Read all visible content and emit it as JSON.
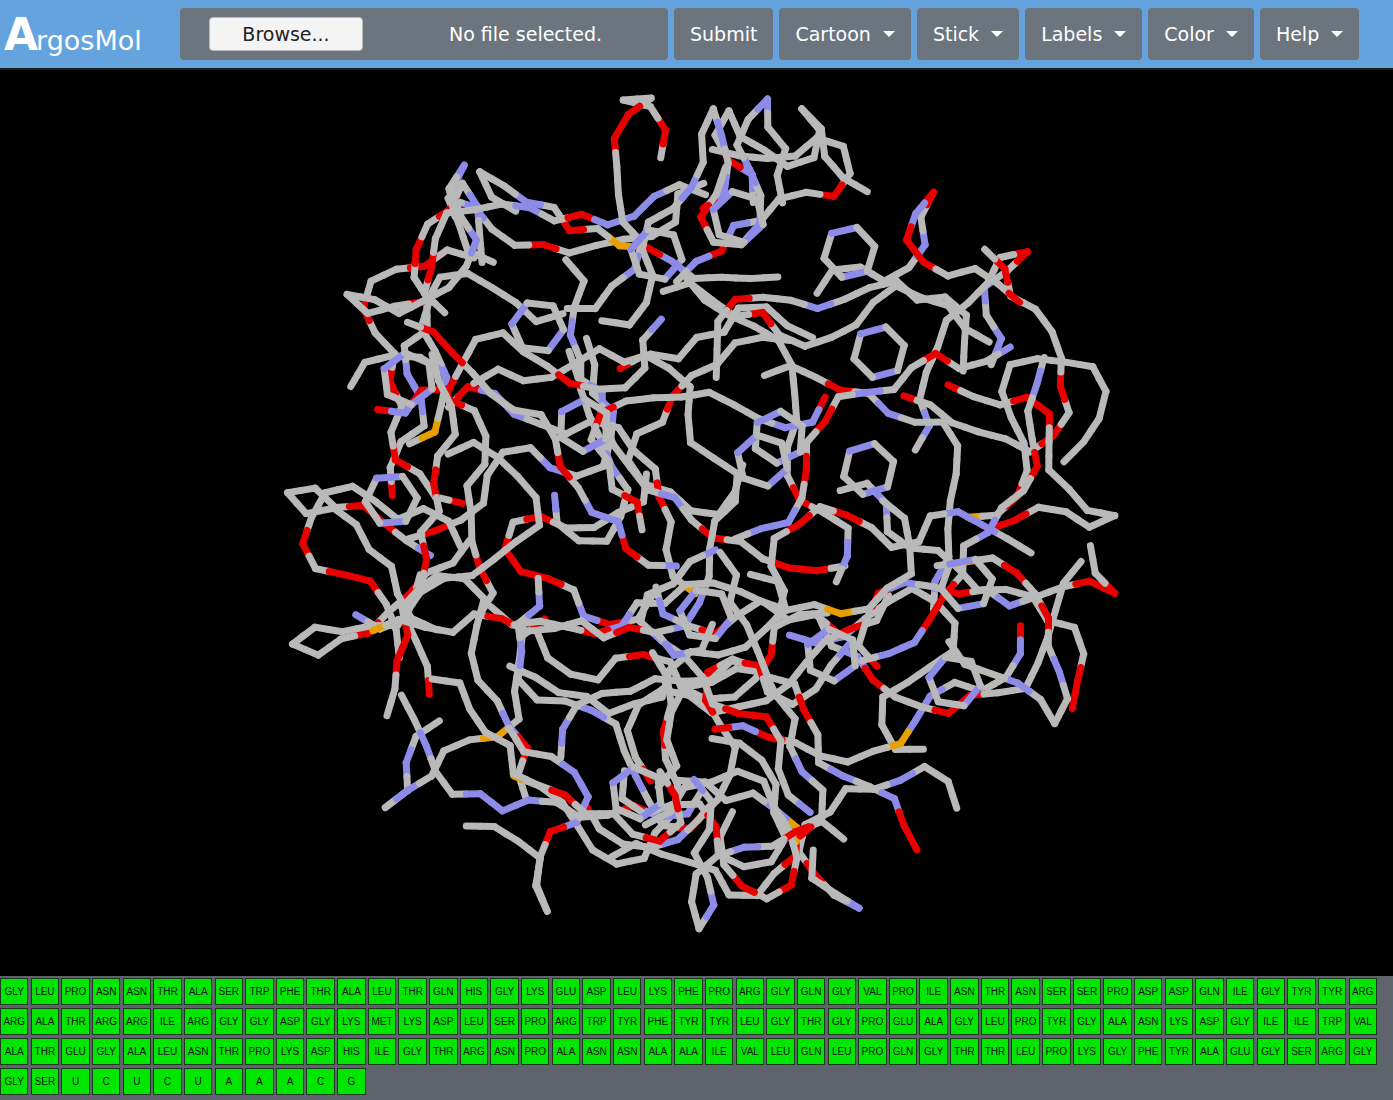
{
  "app": {
    "logo_mark": "A",
    "logo_text": "rgosMol"
  },
  "file": {
    "button": "Browse...",
    "status": "No file selected."
  },
  "toolbar": [
    {
      "label": "Submit",
      "kind": "button"
    },
    {
      "label": "Cartoon",
      "kind": "dropdown"
    },
    {
      "label": "Stick",
      "kind": "dropdown"
    },
    {
      "label": "Labels",
      "kind": "dropdown"
    },
    {
      "label": "Color",
      "kind": "dropdown"
    },
    {
      "label": "Help",
      "kind": "dropdown"
    }
  ],
  "sequence": [
    "GLY",
    "LEU",
    "PRO",
    "ASN",
    "ASN",
    "THR",
    "ALA",
    "SER",
    "TRP",
    "PHE",
    "THR",
    "ALA",
    "LEU",
    "THR",
    "GLN",
    "HIS",
    "GLY",
    "LYS",
    "GLU",
    "ASP",
    "LEU",
    "LYS",
    "PHE",
    "PRO",
    "ARG",
    "GLY",
    "GLN",
    "GLY",
    "VAL",
    "PRO",
    "ILE",
    "ASN",
    "THR",
    "ASN",
    "SER",
    "SER",
    "PRO",
    "ASP",
    "ASP",
    "GLN",
    "ILE",
    "GLY",
    "TYR",
    "TYR",
    "ARG",
    "ARG",
    "ALA",
    "THR",
    "ARG",
    "ARG",
    "ILE",
    "ARG",
    "GLY",
    "GLY",
    "ASP",
    "GLY",
    "LYS",
    "MET",
    "LYS",
    "ASP",
    "LEU",
    "SER",
    "PRO",
    "ARG",
    "TRP",
    "TYR",
    "PHE",
    "TYR",
    "TYR",
    "LEU",
    "GLY",
    "THR",
    "GLY",
    "PRO",
    "GLU",
    "ALA",
    "GLY",
    "LEU",
    "PRO",
    "TYR",
    "GLY",
    "ALA",
    "ASN",
    "LYS",
    "ASP",
    "GLY",
    "ILE",
    "ILE",
    "TRP",
    "VAL",
    "ALA",
    "THR",
    "GLU",
    "GLY",
    "ALA",
    "LEU",
    "ASN",
    "THR",
    "PRO",
    "LYS",
    "ASP",
    "HIS",
    "ILE",
    "GLY",
    "THR",
    "ARG",
    "ASN",
    "PRO",
    "ALA",
    "ASN",
    "ASN",
    "ALA",
    "ALA",
    "ILE",
    "VAL",
    "LEU",
    "GLN",
    "LEU",
    "PRO",
    "GLN",
    "GLY",
    "THR",
    "THR",
    "LEU",
    "PRO",
    "LYS",
    "GLY",
    "PHE",
    "TYR",
    "ALA",
    "GLU",
    "GLY",
    "SER",
    "ARG",
    "GLY",
    "GLY",
    "SER",
    "U",
    "C",
    "U",
    "C",
    "U",
    "A",
    "A",
    "A",
    "C",
    "G"
  ]
}
